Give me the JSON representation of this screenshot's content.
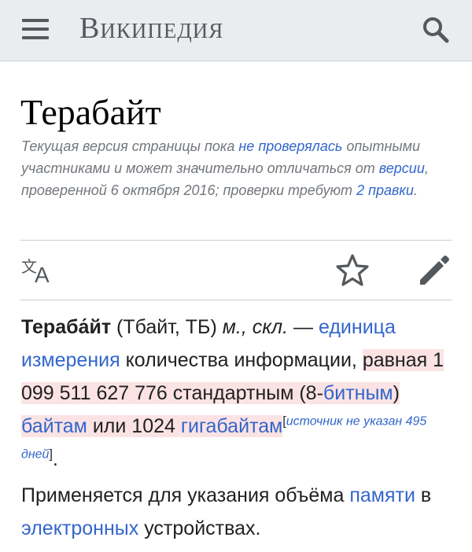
{
  "header": {
    "menu_icon": "hamburger-menu-icon",
    "wordmark": "Википедия",
    "search_icon": "search-icon",
    "background": "#eaecf0"
  },
  "page": {
    "title": "Терабайт"
  },
  "revision_notice": {
    "part1": "Текущая версия страницы пока ",
    "link_not_checked": "не проверялась",
    "part2": " опытными участниками и может значительно отличаться от ",
    "link_version": "версии",
    "part3": ", проверенной 6 октября 2016; проверки требуют ",
    "link_edits": "2 правки",
    "part4": "."
  },
  "actions": {
    "language_icon": "language-icon",
    "watch_icon": "star-icon",
    "edit_icon": "pencil-edit-icon"
  },
  "article": {
    "term": "Тераба́йт",
    "t1": " (Тбайт, ТБ) ",
    "grammar": "м., скл.",
    "t2": " — ",
    "link_unit": "единица измерения",
    "t3": " количества информации, ",
    "hl1": "равная 1 099 511 627 776 стандартным (8-",
    "link_8bit": "битным",
    "hl2": ") ",
    "link_bytes": "байтам",
    "hl3": " или 1024 ",
    "link_gb": "гигабайтам",
    "cite_open": "[",
    "cite_text": "источник не указан 495 дней",
    "cite_close": "]",
    "t4": ".",
    "p2_1": "Применяется для указания объёма ",
    "link_memory": "памяти",
    "p2_2": " в ",
    "link_electronic": "электронных",
    "p2_3": " устройствах."
  },
  "colors": {
    "link": "#3366cc",
    "highlight": "#fbe3e4",
    "muted": "#72777d"
  }
}
